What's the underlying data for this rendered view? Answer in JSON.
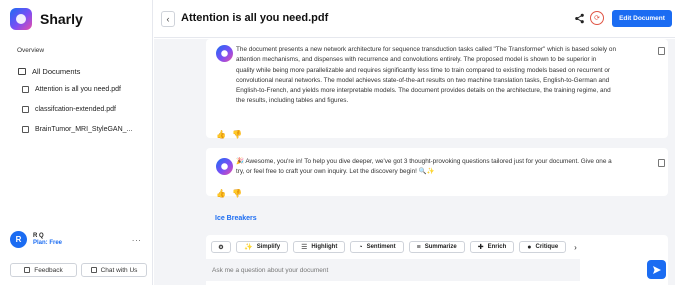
{
  "app": {
    "name": "Sharly"
  },
  "sidebar": {
    "overview_label": "Overview",
    "all_documents_label": "All Documents",
    "documents": [
      {
        "label": "Attention is all you need.pdf"
      },
      {
        "label": "classifcation-extended.pdf"
      },
      {
        "label": "BrainTumor_MRI_StyleGAN_..."
      }
    ],
    "user": {
      "initial": "R",
      "name": "R Q",
      "plan": "Plan: Free",
      "menu": "..."
    },
    "feedback_label": "Feedback",
    "chat_with_us_label": "Chat with Us"
  },
  "header": {
    "back": "‹",
    "title": "Attention is all you need.pdf",
    "edit_label": "Edit Document"
  },
  "messages": [
    {
      "text": "The document presents a new network architecture for sequence transduction tasks called \"The Transformer\" which is based solely on attention mechanisms, and dispenses with recurrence and convolutions entirely. The proposed model is shown to be superior in quality while being more parallelizable and requires significantly less time to train compared to existing models based on recurrent or convolutional neural networks. The model achieves state-of-the-art results on two machine translation tasks, English-to-German and English-to-French, and yields more interpretable models. The document provides details on the architecture, the training regime, and the results, including tables and figures."
    },
    {
      "text": "🎉 Awesome, you're in! To help you dive deeper, we've got 3 thought-provoking questions tailored just for your document. Give one a try, or feel free to craft your own inquiry. Let the discovery begin! 🔍✨"
    }
  ],
  "ice_breakers_label": "Ice Breakers",
  "actions": [
    {
      "label": "Simplify",
      "icon": "sparkle-icon",
      "glyph": "✨"
    },
    {
      "label": "Highlight",
      "icon": "list-icon",
      "glyph": "☰"
    },
    {
      "label": "Sentiment",
      "icon": "pie-icon",
      "glyph": "◔"
    },
    {
      "label": "Summarize",
      "icon": "lines-icon",
      "glyph": "≡"
    },
    {
      "label": "Enrich",
      "icon": "plus-sparkle-icon",
      "glyph": "✚"
    },
    {
      "label": "Critique",
      "icon": "alert-icon",
      "glyph": "●"
    }
  ],
  "composer": {
    "placeholder": "Ask me a question about your document"
  },
  "colors": {
    "accent": "#1b6cf2",
    "thumb_active": "#2e9d4a",
    "sync": "#e05545"
  }
}
